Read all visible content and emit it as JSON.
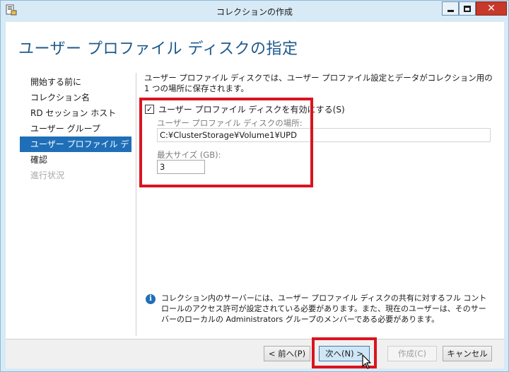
{
  "window": {
    "title": "コレクションの作成"
  },
  "page": {
    "title": "ユーザー プロファイル ディスクの指定"
  },
  "nav": {
    "items": [
      {
        "label": "開始する前に",
        "state": "normal"
      },
      {
        "label": "コレクション名",
        "state": "normal"
      },
      {
        "label": "RD セッション ホスト",
        "state": "normal"
      },
      {
        "label": "ユーザー グループ",
        "state": "normal"
      },
      {
        "label": "ユーザー プロファイル ディスク",
        "state": "active"
      },
      {
        "label": "確認",
        "state": "normal"
      },
      {
        "label": "進行状況",
        "state": "disabled"
      }
    ]
  },
  "content": {
    "description": "ユーザー プロファイル ディスクでは、ユーザー プロファイル設定とデータがコレクション用の 1 つの場所に保存されます。",
    "enable_checkbox": {
      "label": "ユーザー プロファイル ディスクを有効にする(S)",
      "checked": true
    },
    "location": {
      "label": "ユーザー プロファイル ディスクの場所:",
      "value": "C:¥ClusterStorage¥Volume1¥UPD"
    },
    "max_size": {
      "label": "最大サイズ (GB):",
      "value": "3"
    },
    "info_note": "コレクション内のサーバーには、ユーザー プロファイル ディスクの共有に対するフル コントロールのアクセス許可が設定されている必要があります。また、現在のユーザーは、そのサーバーのローカルの Administrators グループのメンバーである必要があります。"
  },
  "buttons": {
    "prev": "< 前へ(P)",
    "next": "次へ(N) >",
    "create": "作成(C)",
    "cancel": "キャンセル"
  },
  "colors": {
    "accent": "#1f6fb8",
    "title_blue": "#1f5a8c",
    "highlight_red": "#d9141f",
    "chrome": "#d7eaf6"
  }
}
